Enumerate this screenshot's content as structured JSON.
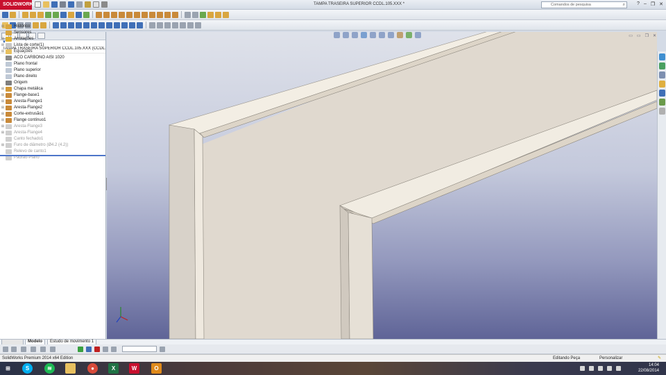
{
  "app": {
    "logo_text": "SOLIDWORKS",
    "document_title": "TAMPA TRASEIRA SUPERIOR CCDL.105.XXX *",
    "search_placeholder": "Comandos de pesquisa",
    "help_label": "?"
  },
  "feature_manager": {
    "filter_icon": "filter-icon",
    "root_name": "TAMPA TRASEIRA SUPERIOR CCDL.105.XXX  (CCDL.10",
    "items": [
      {
        "label": "Histórico",
        "expandable": true,
        "suppressed": false,
        "icon_color": "#d9a640"
      },
      {
        "label": "Sensores",
        "expandable": false,
        "suppressed": false,
        "icon_color": "#d9a640"
      },
      {
        "label": "Anotações",
        "expandable": true,
        "suppressed": false,
        "icon_color": "#e0b030"
      },
      {
        "label": "Lista de corte(1)",
        "expandable": true,
        "suppressed": false,
        "icon_color": "#c7c7c7"
      },
      {
        "label": "Equações",
        "expandable": true,
        "suppressed": false,
        "icon_color": "#e8c060"
      },
      {
        "label": "ACO CARBONO AISI 1020",
        "expandable": false,
        "suppressed": false,
        "icon_color": "#8a8a8a"
      },
      {
        "label": "Plano frontal",
        "expandable": false,
        "suppressed": false,
        "icon_color": "#bfc9d6"
      },
      {
        "label": "Plano superior",
        "expandable": false,
        "suppressed": false,
        "icon_color": "#bfc9d6"
      },
      {
        "label": "Plano direito",
        "expandable": false,
        "suppressed": false,
        "icon_color": "#bfc9d6"
      },
      {
        "label": "Origem",
        "expandable": false,
        "suppressed": false,
        "icon_color": "#7f7f7f"
      },
      {
        "label": "Chapa metálica",
        "expandable": true,
        "suppressed": false,
        "icon_color": "#d49a3a"
      },
      {
        "label": "Flange-base1",
        "expandable": true,
        "suppressed": false,
        "icon_color": "#c98a3a"
      },
      {
        "label": "Aresta-Flange1",
        "expandable": true,
        "suppressed": false,
        "icon_color": "#c98a3a"
      },
      {
        "label": "Aresta-Flange2",
        "expandable": true,
        "suppressed": false,
        "icon_color": "#c98a3a"
      },
      {
        "label": "Corte-extrusão1",
        "expandable": true,
        "suppressed": false,
        "icon_color": "#c98a3a"
      },
      {
        "label": "Flange contínuo1",
        "expandable": true,
        "suppressed": false,
        "icon_color": "#c98a3a"
      },
      {
        "label": "Aresta-Flange3",
        "expandable": true,
        "suppressed": true,
        "icon_color": "#cfcfcf"
      },
      {
        "label": "Aresta-Flange4",
        "expandable": true,
        "suppressed": true,
        "icon_color": "#cfcfcf"
      },
      {
        "label": "Canto fechado1",
        "expandable": false,
        "suppressed": true,
        "icon_color": "#cfcfcf"
      },
      {
        "label": "Furo de diâmetro (Ø4.2 (4.2))",
        "expandable": true,
        "suppressed": true,
        "icon_color": "#cfcfcf"
      },
      {
        "label": "Relevo de canto1",
        "expandable": false,
        "suppressed": true,
        "icon_color": "#cfcfcf"
      },
      {
        "label": "Padrão-Plano",
        "expandable": false,
        "suppressed": true,
        "icon_color": "#cfcfcf"
      }
    ]
  },
  "bottom_tabs": [
    {
      "label": "Modelo"
    },
    {
      "label": "Estudo de movimento 1"
    }
  ],
  "status_bar": {
    "edition": "SolidWorks Premium 2014 x64 Edition",
    "mode": "Editando Peça",
    "customize": "Personalizar"
  },
  "taskbar": {
    "time": "14:04",
    "date": "22/08/2014"
  },
  "colors": {
    "accent_red": "#c8102e",
    "part_face": "#e0d9cf",
    "rollback_bar": "#4d75c9"
  }
}
